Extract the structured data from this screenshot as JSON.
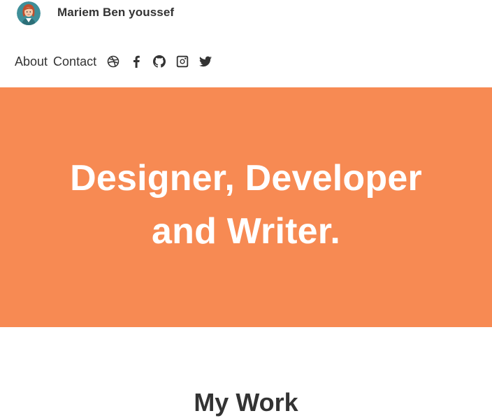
{
  "header": {
    "site_name": "Mariem Ben youssef",
    "avatar_icon": "female-avatar-icon"
  },
  "nav": {
    "links": [
      {
        "label": "About"
      },
      {
        "label": "Contact"
      }
    ],
    "social_icons": [
      "dribbble-icon",
      "facebook-icon",
      "github-icon",
      "instagram-icon",
      "twitter-icon"
    ]
  },
  "hero": {
    "line1": "Designer, Developer",
    "line2": "and Writer.",
    "background_color": "#f78a53",
    "text_color": "#ffffff"
  },
  "sections": {
    "work_title": "My Work"
  }
}
